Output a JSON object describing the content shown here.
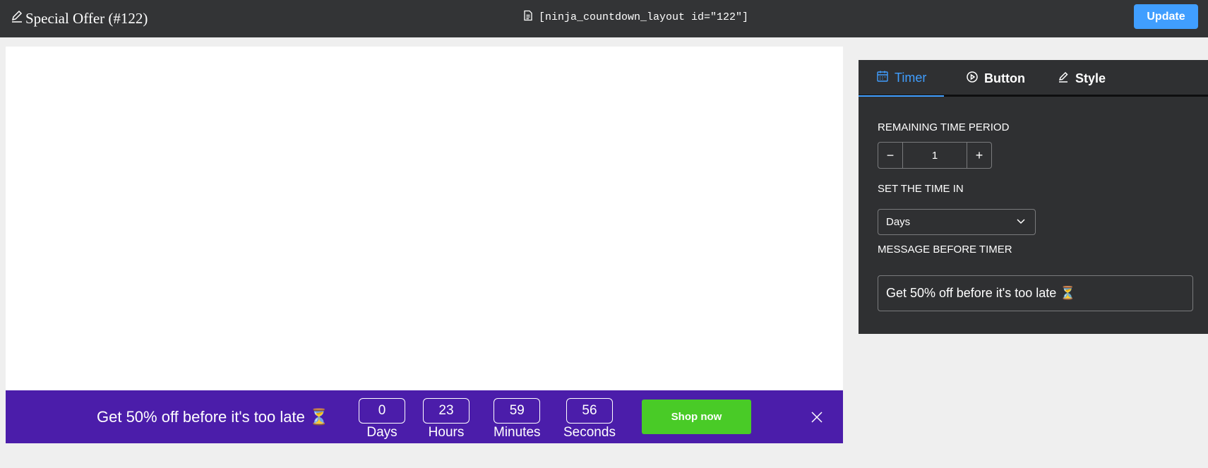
{
  "header": {
    "title": "Special Offer (#122)",
    "shortcode": "[ninja_countdown_layout id=\"122\"]",
    "update_label": "Update"
  },
  "preview": {
    "message": "Get 50% off before it's too late ⏳",
    "units": [
      {
        "value": "0",
        "label": "Days"
      },
      {
        "value": "23",
        "label": "Hours"
      },
      {
        "value": "59",
        "label": "Minutes"
      },
      {
        "value": "56",
        "label": "Seconds"
      }
    ],
    "button_label": "Shop now",
    "colors": {
      "bar": "#4b1daa",
      "button": "#49cb27"
    }
  },
  "panel": {
    "tabs": [
      {
        "label": "Timer",
        "icon": "calendar-icon",
        "active": true
      },
      {
        "label": "Button",
        "icon": "play-circle-icon",
        "active": false
      },
      {
        "label": "Style",
        "icon": "pencil-icon",
        "active": false
      }
    ],
    "remaining_label": "REMAINING TIME PERIOD",
    "remaining_value": "1",
    "set_time_label": "SET THE TIME IN",
    "set_time_value": "Days",
    "message_label": "MESSAGE BEFORE TIMER",
    "message_value": "Get 50% off before it's too late ⏳"
  },
  "colors": {
    "accent": "#409eff",
    "topbar": "#333436",
    "panel": "#2f3032"
  }
}
